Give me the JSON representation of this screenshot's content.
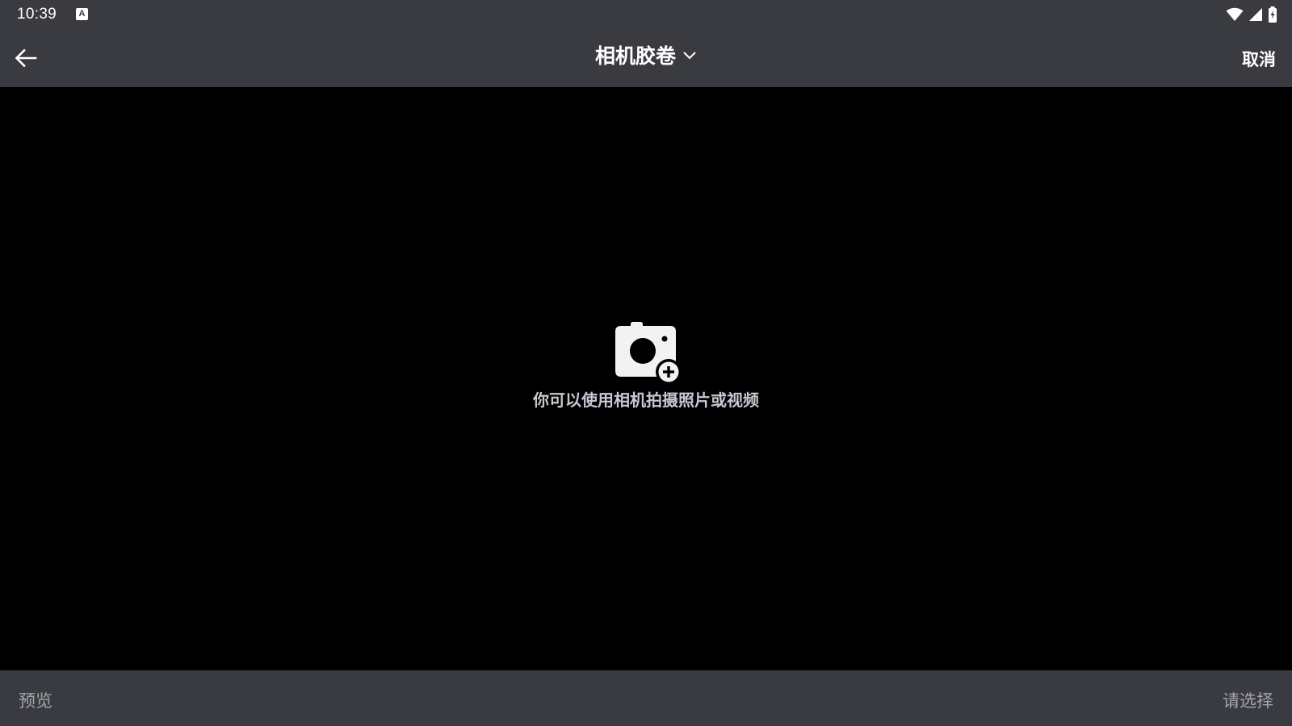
{
  "status_bar": {
    "time": "10:39",
    "notification_icon": "keyboard-a-icon",
    "notification_glyph": "A",
    "icons": [
      "wifi-icon",
      "signal-icon",
      "battery-charging-icon"
    ]
  },
  "app_bar": {
    "back_icon": "arrow-left-icon",
    "title": "相机胶卷",
    "dropdown_icon": "chevron-down-icon",
    "cancel_label": "取消"
  },
  "content": {
    "empty_icon": "camera-add-icon",
    "empty_message": "你可以使用相机拍摄照片或视频"
  },
  "bottom_bar": {
    "preview_label": "预览",
    "select_label": "请选择"
  },
  "colors": {
    "bar_background": "#3a3b40",
    "content_background": "#000000",
    "primary_text": "#ffffff",
    "disabled_text": "#a3a5ab",
    "empty_text": "#c6c9d2"
  }
}
